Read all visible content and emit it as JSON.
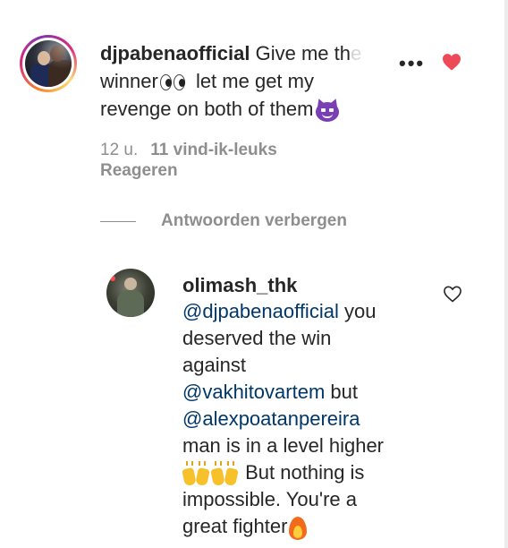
{
  "comment": {
    "username": "djpabenaofficial",
    "text_line1_rest": "Give me th",
    "text_line1_faded": "e",
    "text_line2": "winner",
    "text_line2_after": "let me get my",
    "text_line3": "revenge on both of them",
    "time": "12 u.",
    "likes": "11 vind-ik-leuks",
    "reply_label": "Reageren",
    "liked": true
  },
  "hide_replies_label": "Antwoorden verbergen",
  "reply": {
    "username": "olimash_thk",
    "lines": {
      "l1_mention": "@djpabenaofficial",
      "l1_text": "you",
      "l2": "deserved the win",
      "l3": "against",
      "l4_mention": "@vakhitovartem",
      "l4_text": "but",
      "l5_mention": "@alexpoatanpereira",
      "l6": "man is in a level higher",
      "l7": "But nothing is",
      "l8": "impossible. You're a",
      "l9": "great fighter"
    },
    "liked": false
  },
  "icons": {
    "more": "more-options-icon",
    "heart_filled": "heart-filled-icon",
    "heart_outline": "heart-outline-icon"
  },
  "colors": {
    "text": "#262626",
    "muted": "#8e8e8e",
    "mention": "#00376b",
    "heart": "#ed4956"
  },
  "more_glyph": "•••"
}
